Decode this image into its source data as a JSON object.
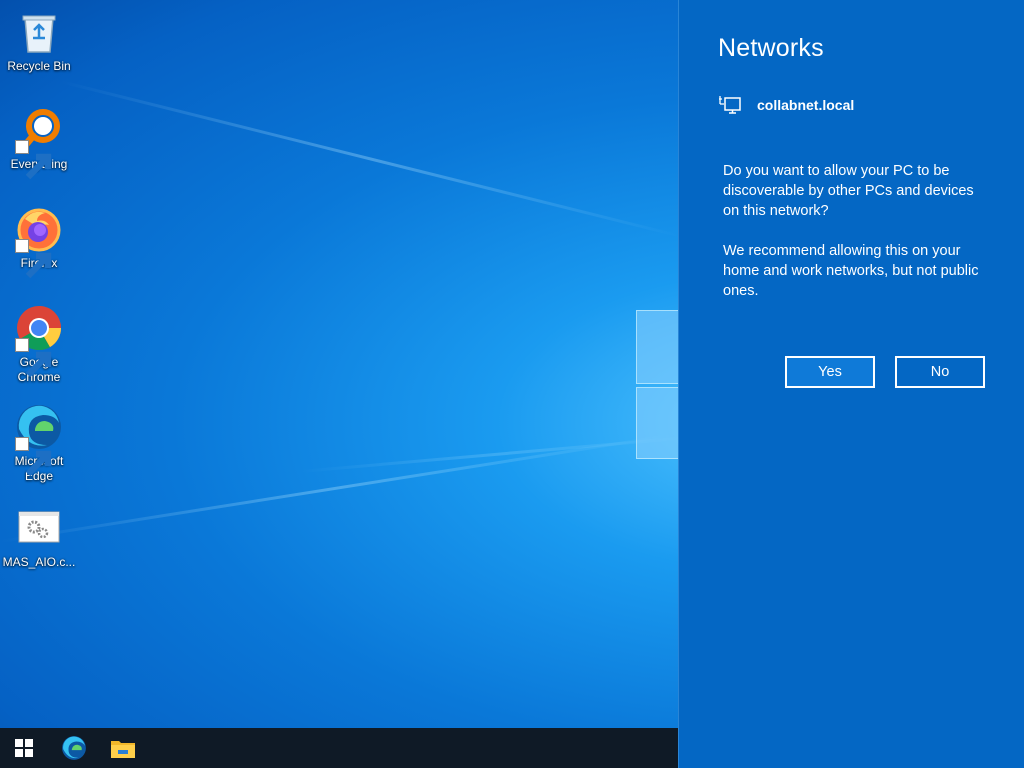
{
  "desktop": {
    "icons": [
      {
        "label": "Recycle Bin",
        "icon": "recycle-bin-icon"
      },
      {
        "label": "Everything",
        "icon": "everything-search-icon"
      },
      {
        "label": "Firefox",
        "icon": "firefox-icon"
      },
      {
        "label": "Google Chrome",
        "icon": "chrome-icon"
      },
      {
        "label": "Microsoft Edge",
        "icon": "edge-icon"
      },
      {
        "label": "MAS_AIO.c...",
        "icon": "script-file-icon"
      }
    ]
  },
  "taskbar": {
    "items": [
      {
        "icon": "windows-start-icon"
      },
      {
        "icon": "edge-icon"
      },
      {
        "icon": "file-explorer-icon"
      }
    ]
  },
  "flyout": {
    "title": "Networks",
    "network_name": "collabnet.local",
    "network_icon": "wired-network-icon",
    "question": "Do you want to allow your PC to be discoverable by other PCs and devices on this network?",
    "recommendation": "We recommend allowing this on your home and work networks, but not public ones.",
    "yes_label": "Yes",
    "no_label": "No"
  },
  "colors": {
    "flyout_bg": "#0467c4",
    "taskbar_bg": "#0f1a26",
    "desktop_accent": "#1a9bf0"
  }
}
